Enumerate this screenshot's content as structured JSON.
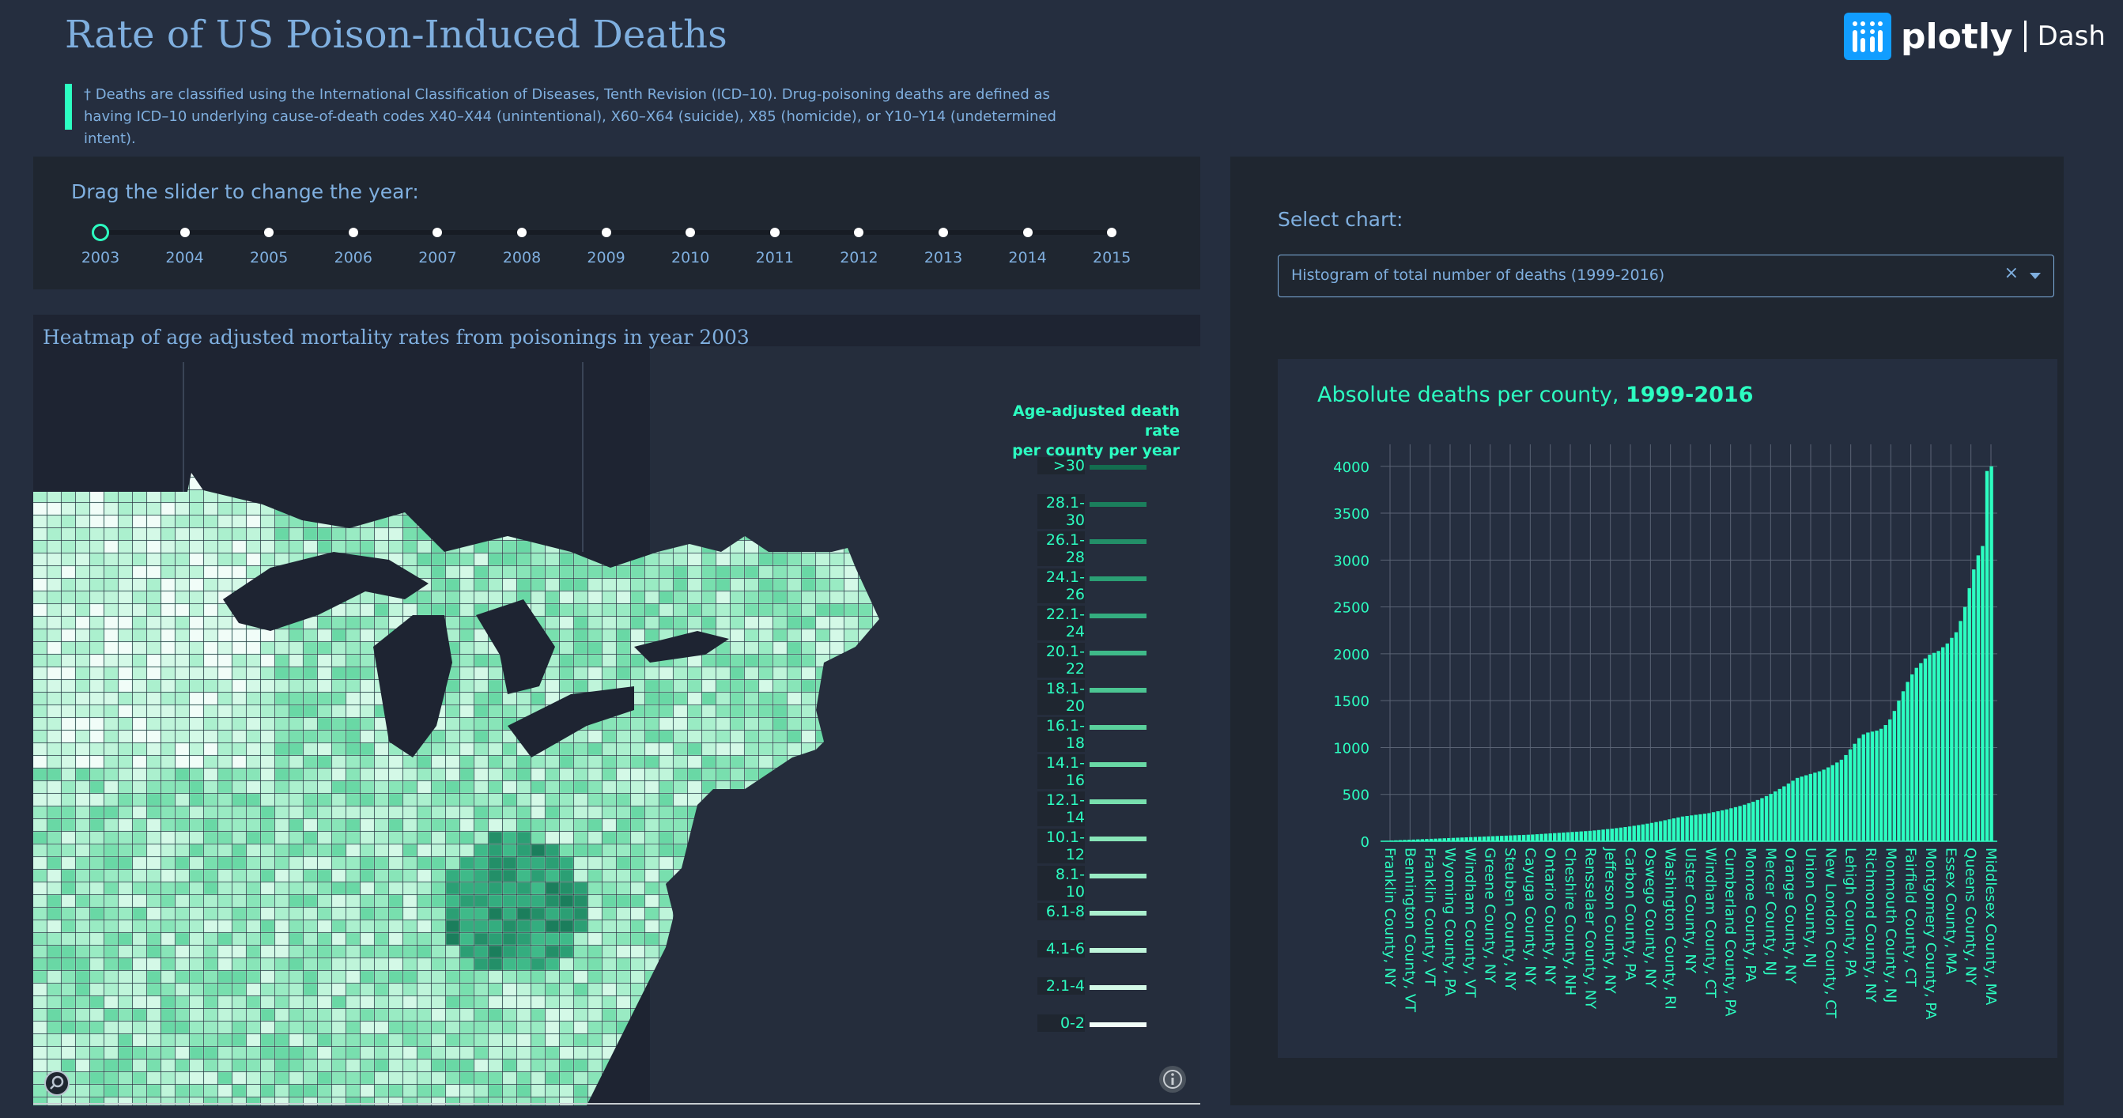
{
  "header": {
    "title": "Rate of US Poison-Induced Deaths",
    "description": "† Deaths are classified using the International Classification of Diseases, Tenth Revision (ICD–10). Drug-poisoning deaths are defined as having ICD–10 underlying cause-of-death codes X40–X44 (unintentional), X60–X64 (suicide), X85 (homicide), or Y10–Y14 (undetermined intent).",
    "logo_word": "plotly",
    "logo_dash": "Dash"
  },
  "slider": {
    "title": "Drag the slider to change the year:",
    "years": [
      "2003",
      "2004",
      "2005",
      "2006",
      "2007",
      "2008",
      "2009",
      "2010",
      "2011",
      "2012",
      "2013",
      "2014",
      "2015"
    ],
    "selected": "2003"
  },
  "map": {
    "title": "Heatmap of age adjusted mortality rates from poisonings in year 2003",
    "legend_title_1": "Age-adjusted death rate",
    "legend_title_2": "per county per year",
    "legend": [
      ">30",
      "28.1-30",
      "26.1-28",
      "24.1-26",
      "22.1-24",
      "20.1-22",
      "18.1-20",
      "16.1-18",
      "14.1-16",
      "12.1-14",
      "10.1-12",
      "8.1-10",
      "6.1-8",
      "4.1-6",
      "2.1-4",
      "0-2"
    ],
    "legend_colors": [
      "#136d4f",
      "#1b7e5c",
      "#238f68",
      "#2b9f74",
      "#34ad7f",
      "#3fba89",
      "#4cc693",
      "#5ad09c",
      "#69d8a5",
      "#78dfae",
      "#88e5b8",
      "#99ebc3",
      "#abf0ce",
      "#bff5da",
      "#d4f9e7",
      "#f1fdf8"
    ]
  },
  "controls": {
    "select_label": "Select chart:",
    "dropdown_value": "Histogram of total number of deaths (1999-2016)"
  },
  "colors": {
    "accent": "#2cfec1",
    "text": "#7fafdf",
    "panel": "#1f2630",
    "page": "#252e3f"
  },
  "chart_data": {
    "type": "bar",
    "title": "Absolute deaths per county, 1999-2016",
    "title_prefix": "Absolute deaths per county, ",
    "title_years": "1999-2016",
    "yticks": [
      0,
      500,
      1000,
      1500,
      2000,
      2500,
      3000,
      3500,
      4000
    ],
    "ylim": [
      0,
      4150
    ],
    "grid": true,
    "tick_labels": [
      "Franklin County, NY",
      "Bennington County, VT",
      "Franklin County, VT",
      "Wyoming County, PA",
      "Windham County, VT",
      "Greene County, NY",
      "Steuben County, NY",
      "Cayuga County, NY",
      "Ontario County, NY",
      "Cheshire County, NH",
      "Rensselaer County, NY",
      "Jefferson County, NY",
      "Carbon County, PA",
      "Oswego County, NY",
      "Washington County, RI",
      "Ulster County, NY",
      "Windham County, CT",
      "Cumberland County, PA",
      "Monroe County, PA",
      "Mercer County, NJ",
      "Orange County, NY",
      "Union County, NJ",
      "New London County, CT",
      "Lehigh County, PA",
      "Richmond County, NY",
      "Monmouth County, NJ",
      "Fairfield County, CT",
      "Montgomery County, PA",
      "Essex County, MA",
      "Queens County, NY",
      "Middlesex County, MA"
    ],
    "values": [
      5,
      8,
      10,
      12,
      14,
      16,
      18,
      20,
      22,
      24,
      26,
      28,
      30,
      32,
      34,
      36,
      38,
      40,
      42,
      44,
      46,
      48,
      50,
      52,
      54,
      56,
      58,
      60,
      62,
      64,
      66,
      68,
      70,
      72,
      75,
      78,
      81,
      84,
      87,
      90,
      93,
      96,
      99,
      102,
      105,
      108,
      111,
      115,
      120,
      125,
      130,
      135,
      140,
      146,
      152,
      158,
      165,
      172,
      180,
      188,
      196,
      205,
      214,
      224,
      234,
      244,
      254,
      264,
      270,
      276,
      282,
      288,
      294,
      300,
      310,
      320,
      330,
      340,
      352,
      364,
      376,
      390,
      406,
      422,
      440,
      460,
      482,
      506,
      532,
      558,
      586,
      616,
      646,
      676,
      690,
      704,
      718,
      732,
      746,
      764,
      788,
      812,
      840,
      870,
      920,
      980,
      1040,
      1100,
      1140,
      1160,
      1170,
      1180,
      1200,
      1240,
      1300,
      1390,
      1500,
      1600,
      1700,
      1780,
      1850,
      1900,
      1950,
      1990,
      2010,
      2030,
      2070,
      2110,
      2170,
      2230,
      2350,
      2500,
      2700,
      2900,
      3050,
      3150,
      3950,
      4000
    ]
  }
}
